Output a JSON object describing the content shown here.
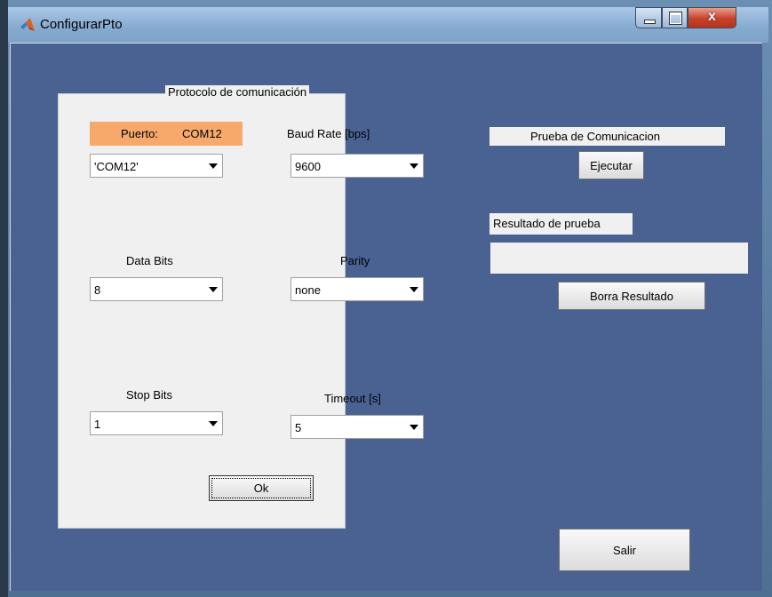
{
  "window": {
    "title": "ConfigurarPto",
    "close_glyph": "x",
    "controls": [
      "minimize",
      "maximize",
      "close"
    ]
  },
  "protocol_panel": {
    "title": "Protocolo de comunicación",
    "port": {
      "label": "Puerto:",
      "value": "COM12",
      "selected": "'COM12'"
    },
    "baud": {
      "label": "Baud Rate [bps]",
      "selected": "9600"
    },
    "data_bits": {
      "label": "Data Bits",
      "selected": "8"
    },
    "parity": {
      "label": "Parity",
      "selected": "none"
    },
    "stop_bits": {
      "label": "Stop Bits",
      "selected": "1"
    },
    "timeout": {
      "label": "Timeout [s]",
      "selected": "5"
    },
    "ok_label": "Ok"
  },
  "test": {
    "title": "Prueba de Comunicacion",
    "run_label": "Ejecutar",
    "result_label": "Resultado de prueba",
    "result_value": "",
    "clear_label": "Borra Resultado"
  },
  "exit_label": "Salir",
  "colors": {
    "client_bg": "#4a6292",
    "panel_bg": "#f0f0f0",
    "port_highlight": "#f7a96b",
    "close_button": "#c5412a"
  },
  "icons": [
    "matlab-logo-icon",
    "minimize-icon",
    "maximize-icon",
    "close-icon",
    "dropdown-arrow-icon"
  ]
}
